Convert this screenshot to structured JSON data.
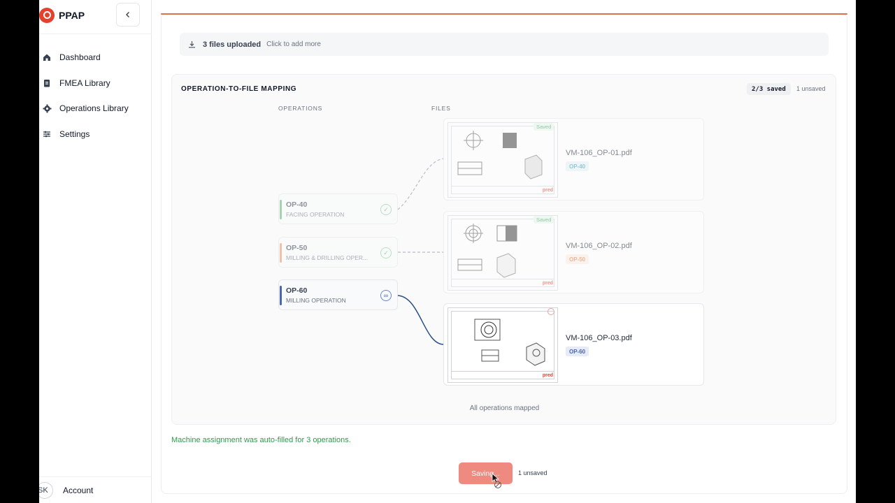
{
  "app": {
    "brand": "PPAP",
    "collapse_icon": "chevron-left-icon"
  },
  "sidebar": {
    "items": [
      {
        "label": "Dashboard",
        "icon": "home-icon"
      },
      {
        "label": "FMEA Library",
        "icon": "clipboard-icon"
      },
      {
        "label": "Operations Library",
        "icon": "gear-icon"
      },
      {
        "label": "Settings",
        "icon": "sliders-icon"
      }
    ],
    "account": {
      "initials": "SK",
      "label": "Account"
    }
  },
  "upload": {
    "count_text": "3 files uploaded",
    "hint": "Click to add more"
  },
  "mapping": {
    "title": "OPERATION-TO-FILE MAPPING",
    "saved_badge": "2/3 saved",
    "unsaved": "1 unsaved",
    "operations_header": "OPERATIONS",
    "files_header": "FILES",
    "operations": [
      {
        "id": "OP-40",
        "name": "FACING OPERATION",
        "color": "#5fb37a",
        "status": "mapped-saved"
      },
      {
        "id": "OP-50",
        "name": "MILLING & DRILLING OPER...",
        "color": "#e6946a",
        "status": "mapped-saved"
      },
      {
        "id": "OP-60",
        "name": "MILLING OPERATION",
        "color": "#4a66ae",
        "status": "mapped-unsaved"
      }
    ],
    "files": [
      {
        "name": "VM-106_OP-01.pdf",
        "op": "OP-40",
        "saved_label": "Saved",
        "tag_color": "#3f9fb7",
        "tag_bg": "#e3f2f6",
        "state": "saved"
      },
      {
        "name": "VM-106_OP-02.pdf",
        "op": "OP-50",
        "saved_label": "Saved",
        "tag_color": "#e0824e",
        "tag_bg": "#fbede4",
        "state": "saved"
      },
      {
        "name": "VM-106_OP-03.pdf",
        "op": "OP-60",
        "saved_label": "",
        "tag_color": "#4a66ae",
        "tag_bg": "#e6ebf6",
        "state": "unsaved"
      }
    ],
    "thumb_brand": "pred",
    "footer": "All operations mapped"
  },
  "autofill_message": "Machine assignment was auto-filled for 3 operations.",
  "save_button": {
    "label": "Saving...",
    "unsaved": "1 unsaved"
  },
  "colors": {
    "accent": "#e4412f",
    "save_button": "#ef8a80",
    "success": "#2e9a4f"
  }
}
